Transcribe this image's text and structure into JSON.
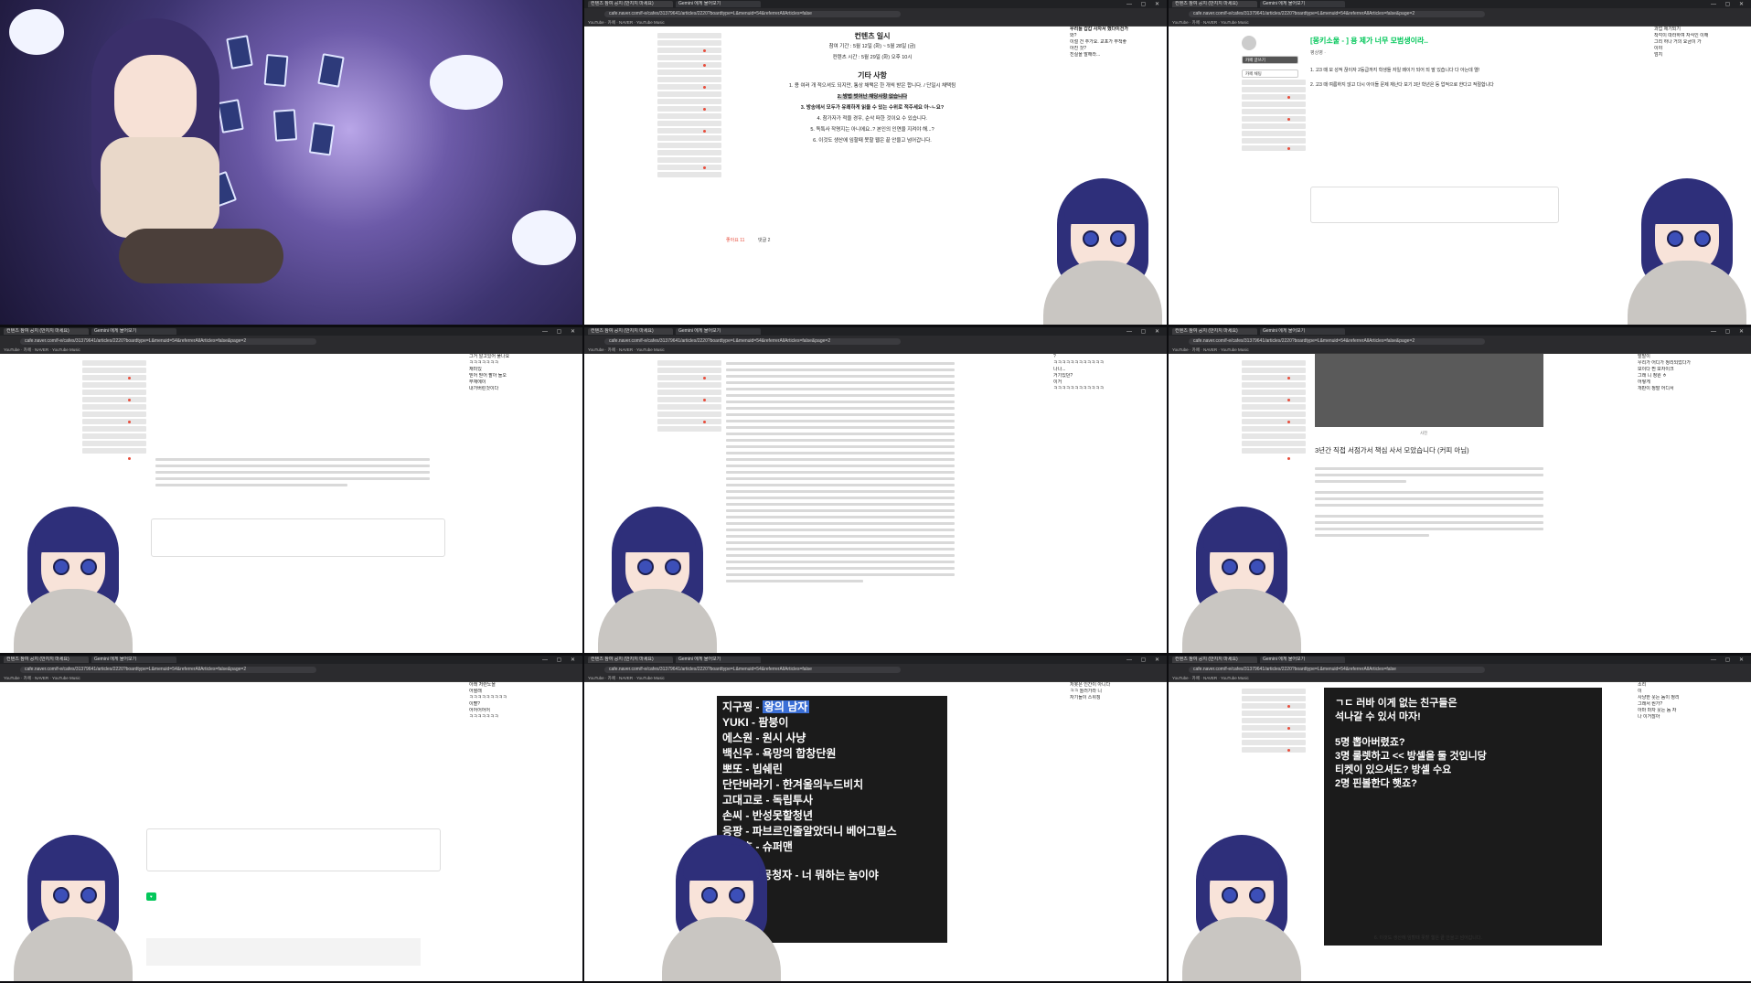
{
  "browser": {
    "url": "cafe.naver.com/f-e/cafes/31379641/articles/2220?boardtype=L&menuid=54&referrerAllArticles=false",
    "url_page2": "cafe.naver.com/f-e/cafes/31379641/articles/2220?boardtype=L&menuid=54&referrerAllArticles=false&page=2",
    "bookmarks": "YouTube · 카페 · NAVER · YouTube Music",
    "tab_label": "컨텐츠 참여 공지 (만지지 마세요)",
    "tab2_label": "Gemini 에게 물어보기"
  },
  "p2": {
    "title": "컨텐츠 일시",
    "line1": "참여 기간 : 5월 12일 (화) ~ 5월 28일 (금)",
    "line2": "컨텐츠 시간 : 5월 29일 (화) 오후 10시",
    "section": "기타 사항",
    "item1": "1. 용 여러 개 적으셔도 되지만, 통상 채택은 한 개씩 받은 합니다. / 단일시 채택됨",
    "item2": "2. 방법 벗어난 채당사항 없습니다",
    "item3": "3. 방송에서 모두가 유쾌하게 읽을 수 있는 수위로 적주세요 아~ㄴ요?",
    "item4": "4. 참가자가 적을 경우, 순삭 떠한 것이요 수 있습니다.",
    "item5": "5. 독특사 작명지는 아니에요..? 본인의 인연을 지켜야 해...?",
    "item6": "6. 이것도 생산에 임할때 못할 웹은 끝 안을고 넘어갑니다.",
    "likes": "좋아요 11",
    "comments": "댓글 2"
  },
  "p3": {
    "title": "[몽키소울 - ] 용 제가 너무 모범생이라..",
    "author": "평상병 ·",
    "line1": "1. 고3 때 모 성적 끊이자 2등급까지 학생들 자일 왜이가 되어 되 말 있습니다 다 아는데 엘!",
    "line2": "2. 고3 때 여름하지 않고 다시 아이들 문제 재난다 보기 3단 학년은 등 업적으로 한다고 적절합니다",
    "write_btn": "카페 글쓰기",
    "chat_btn": "카페 채팅"
  },
  "p6": {
    "title": "3년간 직접 서점가서 책심 사서 모았습니다 (커피 아님)",
    "caption": "사진"
  },
  "p8": {
    "lines": [
      {
        "a": "지구찡",
        "b": "왕의 남자"
      },
      {
        "a": "YUKI",
        "b": "팜붕이"
      },
      {
        "a": "에스원",
        "b": "원시 사냥"
      },
      {
        "a": "백신우",
        "b": "욕망의 합창단원"
      },
      {
        "a": "뽀또",
        "b": "빕쉐린"
      },
      {
        "a": "단단바라기",
        "b": "한겨울의누드비치"
      },
      {
        "a": "고대고로",
        "b": "독립투사"
      },
      {
        "a": "손씨",
        "b": "반성못할청년"
      },
      {
        "a": "응팡",
        "b": "파브르인줄알았더니 베어그릴스"
      },
      {
        "a": "천강호",
        "b": "슈퍼맨"
      }
    ],
    "last": ">>>메타몽청자 - 너 뭐하는 놈이야"
  },
  "p9": {
    "line1": "ㄱㄷ 러바 이게 없는 친구들은",
    "line2": "석나갈 수 있서 마자!",
    "line3": "5명 뽑아버렸죠?",
    "line4": "3명 룰렛하고 << 방셀을 둘 것입니당",
    "line5": "티켓이 있으셔도? 방셀 수요",
    "line6": "2명 핀볼한다 햇죠?",
    "footer": "6. 이것도 생산에 임할때 못할 웹은 끝 안을고 넘어갑니다."
  },
  "chat": {
    "p2": [
      "우리들 갑갑 사자서 했다이건가",
      "와?",
      "이럴 건 추가요. 교포가 무척좋",
      "아진 것?",
      "진실을 말해라..."
    ],
    "p3": [
      "과업 제기되기",
      "착각이 따라하여 자식인 이해",
      "그리 하나 거의 요금이 가",
      "이야",
      "엄지"
    ],
    "p4": [
      "그거 알고있어 풀나요",
      "ㅋㅋㅋㅋㅋㅋㅋ",
      "재미있",
      "믿어 믿어 팔아 들오",
      "부재에이",
      "내가버린것이다"
    ],
    "p5": [
      "?",
      "ㅋㅋㅋㅋㅋㅋㅋㅋㅋㅋㅋㅋ",
      "나나...",
      "거기있던?",
      "이거",
      "ㅋㅋㅋㅋㅋㅋㅋㅋㅋㅋㅋㅋ"
    ],
    "p6": [
      "발발이",
      "우리가 어디가 정리되었다가",
      "보이다 찐 모자이크",
      "그래 니 정원 ㅎ",
      "어떻게",
      "개판이 정말 어디서"
    ],
    "p7": [
      "아래 저런노을",
      "어쩔래",
      "ㅋㅋㅋㅋㅋㅋㅋㅋㅋ",
      "이빨?",
      "어어어어어",
      "ㅋㅋㅋㅋㅋㅋㅋ"
    ],
    "p8": [
      "저봇은 인간이 아니다",
      "ㅋㅋ 놀러가라 니",
      "자기들이 스위칭"
    ],
    "p9": [
      "소리",
      "이",
      "사냥한 웃는 놈이 정리",
      "그래서 뭔가?",
      "아마 마차 웃는 놈 자",
      "나 이거잖아"
    ]
  }
}
